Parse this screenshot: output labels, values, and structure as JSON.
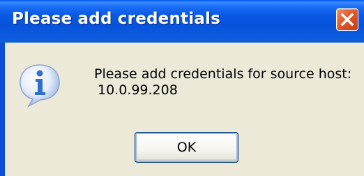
{
  "dialog": {
    "title": "Please add credentials",
    "message_line1": "Please add credentials for source host:",
    "message_line2": "10.0.99.208",
    "ok_label": "OK",
    "icon": "info-icon",
    "close_icon": "close-icon"
  },
  "colors": {
    "titlebar": "#0a5ae6",
    "client_background": "#ece9d8",
    "close_button": "#e05a2b",
    "button_border": "#003c74",
    "info_icon": "#2f6fd0"
  }
}
